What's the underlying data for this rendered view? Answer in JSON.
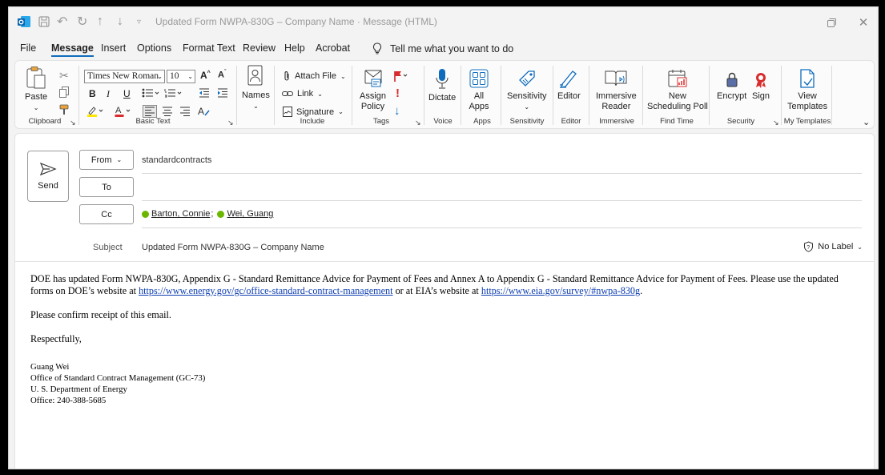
{
  "titlebar": {
    "title": "Updated Form NWPA-830G – Company Name · Message (HTML)",
    "icons": [
      "outlook-icon",
      "save-icon",
      "undo-icon",
      "redo-icon",
      "up-icon",
      "down-icon",
      "customize-icon"
    ]
  },
  "menu": {
    "tabs": [
      "File",
      "Message",
      "Insert",
      "Options",
      "Format Text",
      "Review",
      "Help",
      "Acrobat"
    ],
    "active": "Message",
    "tell_me": "Tell me what you want to do"
  },
  "ribbon": {
    "clipboard": {
      "label": "Clipboard",
      "paste": "Paste"
    },
    "basic_text": {
      "label": "Basic Text",
      "font": "Times New Roman",
      "size": "10"
    },
    "names": {
      "label": "Names"
    },
    "include": {
      "label": "Include",
      "attach": "Attach File",
      "link": "Link",
      "signature": "Signature"
    },
    "tags": {
      "label": "Tags",
      "assign_line1": "Assign",
      "assign_line2": "Policy"
    },
    "voice": {
      "label": "Voice",
      "dictate": "Dictate"
    },
    "apps": {
      "label": "Apps",
      "all_line1": "All",
      "all_line2": "Apps"
    },
    "sensitivity": {
      "label": "Sensitivity",
      "button": "Sensitivity"
    },
    "editor": {
      "label": "Editor",
      "button": "Editor"
    },
    "immersive": {
      "label": "Immersive",
      "line1": "Immersive",
      "line2": "Reader"
    },
    "find_time": {
      "label": "Find Time",
      "line1": "New",
      "line2": "Scheduling Poll"
    },
    "security": {
      "label": "Security",
      "encrypt": "Encrypt",
      "sign": "Sign"
    },
    "templates": {
      "label": "My Templates",
      "line1": "View",
      "line2": "Templates"
    }
  },
  "compose": {
    "send": "Send",
    "from_label": "From",
    "from_value": "standardcontracts",
    "to_label": "To",
    "cc_label": "Cc",
    "cc": [
      {
        "name": "Barton, Connie",
        "sep": ";"
      },
      {
        "name": "Wei, Guang",
        "sep": ""
      }
    ],
    "subject_label": "Subject",
    "subject_value": "Updated Form NWPA-830G – Company Name",
    "label_button": "No Label"
  },
  "body": {
    "p1_a": "DOE has updated Form NWPA-830G, Appendix G - Standard Remittance Advice for Payment of Fees and Annex A to Appendix G - Standard Remittance Advice for Payment of Fees. Please use the updated forms on DOE’s website at ",
    "link1": "https://www.energy.gov/gc/office-standard-contract-management",
    "p1_b": " or at EIA’s website at ",
    "link2": "https://www.eia.gov/survey/#nwpa-830g",
    "p1_c": ".",
    "p2": "Please confirm receipt of this email.",
    "p3": "Respectfully,",
    "sig_name": "Guang Wei",
    "sig_office": "Office of Standard Contract Management (GC-73)",
    "sig_dept": "U. S. Department of Energy",
    "sig_phone": "Office: 240-388-5685"
  }
}
